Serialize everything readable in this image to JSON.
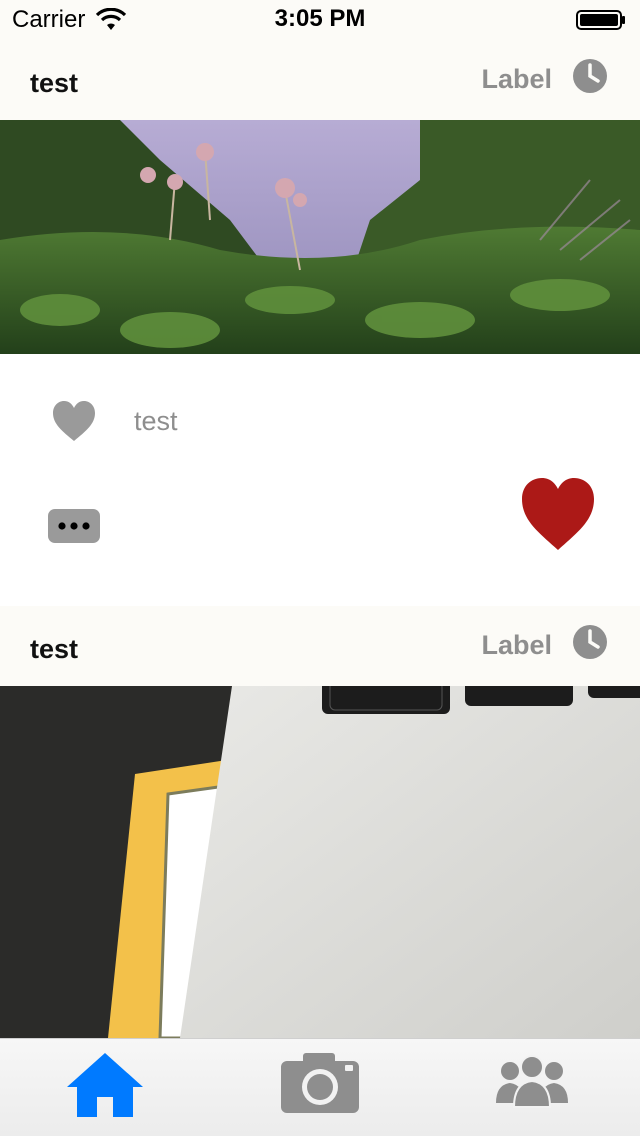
{
  "status_bar": {
    "carrier": "Carrier",
    "time": "3:05 PM"
  },
  "posts": [
    {
      "username": "test",
      "label": "Label",
      "likes_text": "test"
    },
    {
      "username": "test",
      "label": "Label"
    }
  ],
  "colors": {
    "accent": "#007aff",
    "heart": "#ac1917",
    "muted": "#8e8e8e"
  },
  "tab_bar": {
    "items": [
      {
        "icon": "home-icon",
        "selected": true
      },
      {
        "icon": "camera-icon",
        "selected": false
      },
      {
        "icon": "friends-icon",
        "selected": false
      }
    ]
  }
}
